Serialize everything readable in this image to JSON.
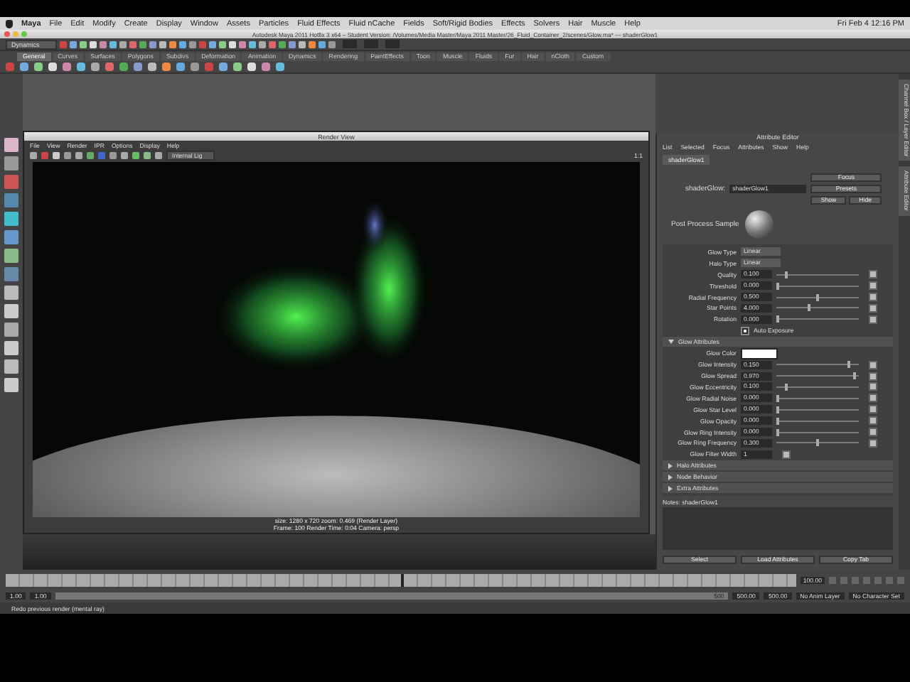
{
  "menu_bar": {
    "items": [
      "Maya",
      "File",
      "Edit",
      "Modify",
      "Create",
      "Display",
      "Window",
      "Assets",
      "Particles",
      "Fluid Effects",
      "Fluid nCache",
      "Fields",
      "Soft/Rigid Bodies",
      "Effects",
      "Solvers",
      "Hair",
      "Muscle",
      "Help"
    ],
    "clock": "Fri Feb 4 12:16 PM"
  },
  "window": {
    "title": "Autodesk Maya 2011 Hotfix 3 x64 – Student Version: /Volumes/Media Master/Maya 2011 Master/26_Fluid_Container_2/scenes/Glow.ma* --- shaderGlow1"
  },
  "status_line": {
    "mode": "Dynamics"
  },
  "shelf": {
    "tabs": [
      {
        "label": "General",
        "selected": true
      },
      {
        "label": "Curves",
        "selected": false
      },
      {
        "label": "Surfaces",
        "selected": false
      },
      {
        "label": "Polygons",
        "selected": false
      },
      {
        "label": "Subdivs",
        "selected": false
      },
      {
        "label": "Deformation",
        "selected": false
      },
      {
        "label": "Animation",
        "selected": false
      },
      {
        "label": "Dynamics",
        "selected": false
      },
      {
        "label": "Rendering",
        "selected": false
      },
      {
        "label": "PaintEffects",
        "selected": false
      },
      {
        "label": "Toon",
        "selected": false
      },
      {
        "label": "Muscle",
        "selected": false
      },
      {
        "label": "Fluids",
        "selected": false
      },
      {
        "label": "Fur",
        "selected": false
      },
      {
        "label": "Hair",
        "selected": false
      },
      {
        "label": "nCloth",
        "selected": false
      },
      {
        "label": "Custom",
        "selected": false
      }
    ]
  },
  "render_view": {
    "title": "Render View",
    "menu": [
      "File",
      "View",
      "Render",
      "IPR",
      "Options",
      "Display",
      "Help"
    ],
    "camera": "Internal Lig",
    "zoom": "1:1",
    "info_line1": "size: 1280 x 720 zoom: 0.469    (Render Layer)",
    "info_line2": "Frame: 100    Render Time: 0:04    Camera: persp"
  },
  "attribute_editor": {
    "title": "Attribute Editor",
    "menu": [
      "List",
      "Selected",
      "Focus",
      "Attributes",
      "Show",
      "Help"
    ],
    "tab": "shaderGlow1",
    "node_label": "shaderGlow:",
    "node_name": "shaderGlow1",
    "buttons": [
      "Focus",
      "Presets"
    ],
    "show": "Show",
    "hide": "Hide",
    "sample_label": "Post Process Sample",
    "rows": [
      {
        "kind": "dropdown",
        "label": "Glow Type",
        "value": "Linear"
      },
      {
        "kind": "dropdown",
        "label": "Halo Type",
        "value": "Linear"
      },
      {
        "kind": "slider",
        "label": "Quality",
        "value": "0.100",
        "level": 0.1
      },
      {
        "kind": "slider",
        "label": "Threshold",
        "value": "0.000",
        "level": 0.0
      },
      {
        "kind": "slider",
        "label": "Radial Frequency",
        "value": "0.500",
        "level": 0.5
      },
      {
        "kind": "slider",
        "label": "Star Points",
        "value": "4.000",
        "level": 0.4
      },
      {
        "kind": "slider",
        "label": "Rotation",
        "value": "0.000",
        "level": 0.0
      },
      {
        "kind": "checkbox",
        "label": "Auto Exposure",
        "checked": true
      },
      {
        "kind": "section",
        "label": "Glow Attributes",
        "expanded": true
      },
      {
        "kind": "color",
        "label": "Glow Color",
        "color": "#ffffff"
      },
      {
        "kind": "slider",
        "label": "Glow Intensity",
        "value": "0.150",
        "level": 0.9
      },
      {
        "kind": "slider",
        "label": "Glow Spread",
        "value": "0.970",
        "level": 0.97
      },
      {
        "kind": "slider",
        "label": "Glow Eccentricity",
        "value": "0.100",
        "level": 0.1
      },
      {
        "kind": "slider",
        "label": "Glow Radial Noise",
        "value": "0.000",
        "level": 0.0
      },
      {
        "kind": "slider",
        "label": "Glow Star Level",
        "value": "0.000",
        "level": 0.0
      },
      {
        "kind": "slider",
        "label": "Glow Opacity",
        "value": "0.000",
        "level": 0.0
      },
      {
        "kind": "slider",
        "label": "Glow Ring Intensity",
        "value": "0.000",
        "level": 0.0
      },
      {
        "kind": "slider",
        "label": "Glow Ring Frequency",
        "value": "0.300",
        "level": 0.5
      },
      {
        "kind": "field",
        "label": "Glow Filter Width",
        "value": "1"
      },
      {
        "kind": "section",
        "label": "Halo Attributes",
        "expanded": false
      },
      {
        "kind": "section",
        "label": "Node Behavior",
        "expanded": false
      },
      {
        "kind": "section",
        "label": "Extra Attributes",
        "expanded": false
      }
    ],
    "notes_label": "Notes:  shaderGlow1",
    "bottom_buttons": [
      "Select",
      "Load Attributes",
      "Copy Tab"
    ]
  },
  "side_tabs": [
    "Channel Box / Layer Editor",
    "Attribute Editor"
  ],
  "timeline": {
    "level": 0.5,
    "current_frame": "100.00"
  },
  "range": {
    "level": 1,
    "start": "1.00",
    "inner_start": "1.00",
    "inner_end": "500",
    "end": "500.00",
    "end_outer": "500.00",
    "anim_layer": "No Anim Layer",
    "character_set": "No Character Set"
  },
  "help_line": "Redo previous render (mental ray)"
}
